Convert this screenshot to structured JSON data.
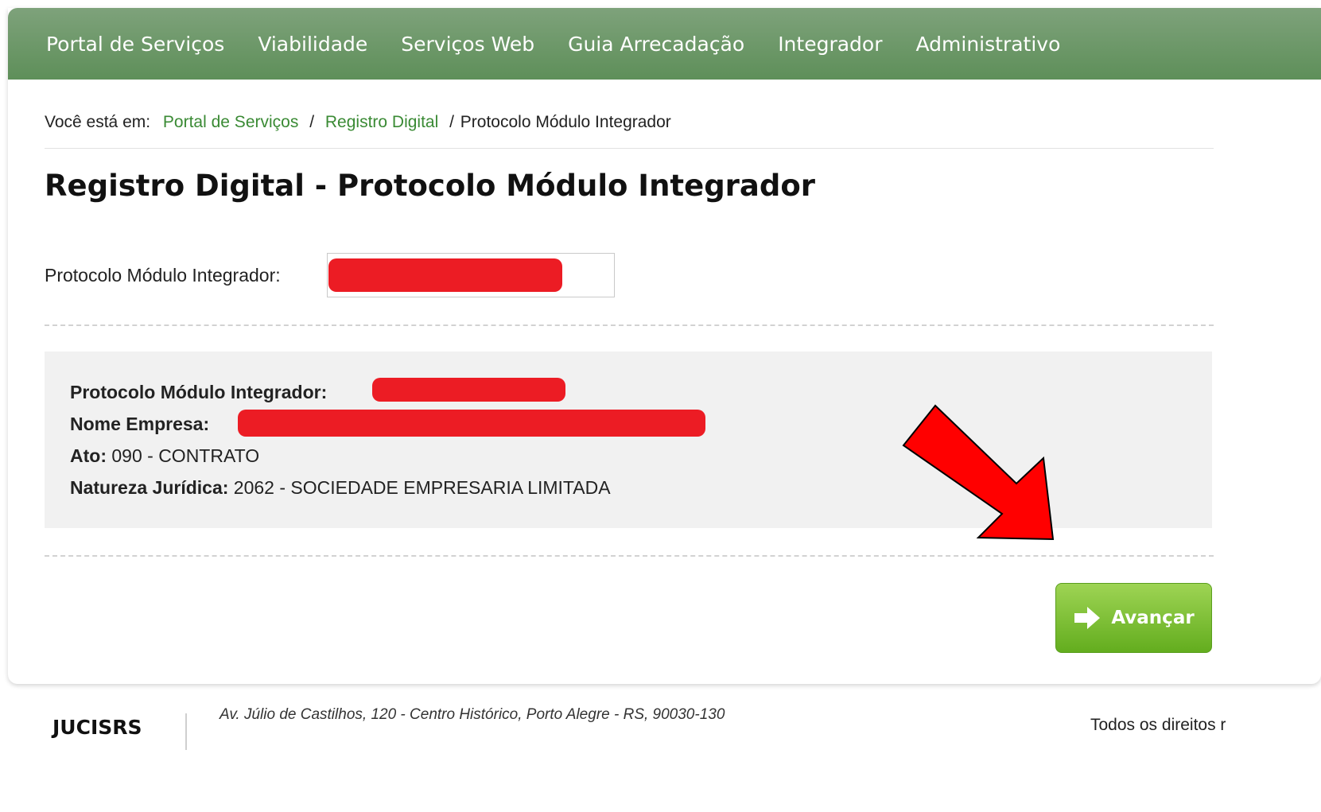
{
  "nav": {
    "items": [
      {
        "label": "Portal de Serviços"
      },
      {
        "label": "Viabilidade"
      },
      {
        "label": "Serviços Web"
      },
      {
        "label": "Guia Arrecadação"
      },
      {
        "label": "Integrador"
      },
      {
        "label": "Administrativo"
      }
    ]
  },
  "breadcrumb": {
    "prefix": "Você está em:",
    "items": [
      {
        "label": "Portal de Serviços"
      },
      {
        "label": "Registro Digital"
      },
      {
        "label": "Protocolo Módulo Integrador"
      }
    ],
    "separator": "/"
  },
  "page": {
    "title": "Registro Digital - Protocolo Módulo Integrador"
  },
  "form": {
    "protocol_label": "Protocolo Módulo Integrador:"
  },
  "info": {
    "protocol_label": "Protocolo Módulo Integrador:",
    "company_label": "Nome Empresa:",
    "act_label": "Ato:",
    "act_value": "090 - CONTRATO",
    "nature_label": "Natureza Jurídica:",
    "nature_value": "2062 - SOCIEDADE EMPRESARIA LIMITADA"
  },
  "actions": {
    "advance_label": "Avançar"
  },
  "footer": {
    "brand": "JUCISRS",
    "address": "Av. Júlio de Castilhos, 120 - Centro Histórico, Porto Alegre - RS, 90030-130",
    "rights": "Todos os direitos r"
  },
  "colors": {
    "nav_green": "#6a9766",
    "link_green": "#3a8a34",
    "button_green": "#7cc234",
    "redaction_red": "#ec1c24",
    "annotation_arrow": "#ff0000"
  }
}
